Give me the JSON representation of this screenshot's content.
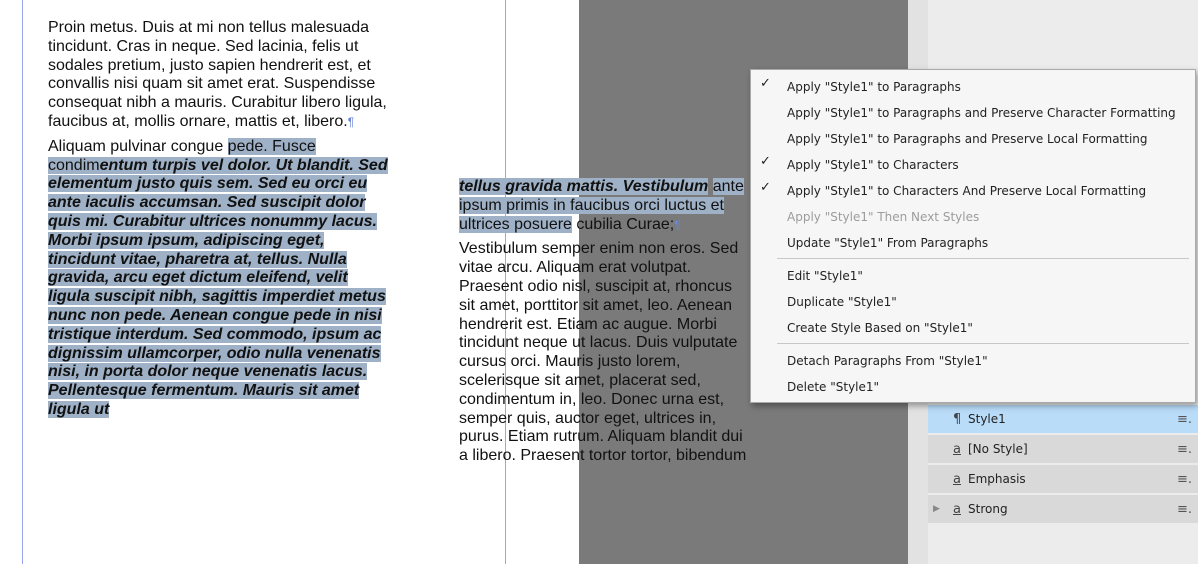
{
  "document": {
    "col1_para1": "Proin metus. Duis at mi non tellus malesuada tincidunt. Cras in neque. Sed lacinia, felis ut sodales pretium, justo sapien hendrerit est, et convallis nisi quam sit amet erat. Suspendisse consequat nibh a mauris. Curabitur libero ligula, faucibus at, mollis ornare, mattis et, libero.",
    "col1_para2_plain": "Aliquam pulvinar congue ",
    "col1_para2_sel_plain": "pede. Fusce condim",
    "col1_para2_sel_bold": "entum turpis vel dolor. Ut blandit. Sed elementum justo quis sem. Sed eu orci eu ante iaculis accumsan. Sed suscipit dolor quis mi. Curabitur ultrices nonummy lacus. Morbi ipsum ipsum, adipiscing eget, tincidunt vitae, pharetra at, tellus. Nulla gravida, arcu eget dictum eleifend, velit ligula suscipit nibh, sagittis imperdiet metus nunc non pede. Aenean congue pede in nisi tristique interdum. Sed commodo, ipsum ac dignissim ullamcorper, odio nulla venenatis nisi, in porta dolor neque venenatis lacus. Pellentesque fermentum. Mauris sit amet ligula ut",
    "col2_sel_bold": "tellus gravida mattis. Vestibulum",
    "col2_sel_plain": "ante ipsum primis in faucibus orci luctus et ultrices posuere",
    "col2_para1_rest": " cubilia Curae;",
    "col2_para2": "Vestibulum semper enim non eros. Sed vitae arcu. Aliquam erat volutpat. Praesent odio nisl, suscipit at, rhoncus sit amet, porttitor sit amet, leo. Aenean hendrerit est. Etiam ac augue. Morbi tincidunt neque ut lacus. Duis vulputate cursus orci. Mauris justo lorem, scelerisque sit amet, placerat sed, condimentum in, leo. Donec urna est, semper quis, auctor eget, ultrices in, purus. Etiam rutrum. Aliquam blandit dui a libero. Praesent tortor tortor, bibendum"
  },
  "context_menu": {
    "items": [
      {
        "label": "Apply \"Style1\" to Paragraphs",
        "checked": true,
        "disabled": false
      },
      {
        "label": "Apply \"Style1\" to Paragraphs and Preserve Character Formatting",
        "checked": false,
        "disabled": false
      },
      {
        "label": "Apply \"Style1\" to Paragraphs and Preserve Local Formatting",
        "checked": false,
        "disabled": false
      },
      {
        "label": "Apply \"Style1\" to Characters",
        "checked": true,
        "disabled": false
      },
      {
        "label": "Apply \"Style1\" to Characters And Preserve Local Formatting",
        "checked": true,
        "disabled": false
      },
      {
        "label": "Apply \"Style1\" Then Next Styles",
        "checked": false,
        "disabled": true
      },
      {
        "label": "Update \"Style1\" From Paragraphs",
        "checked": false,
        "disabled": false
      },
      {
        "label": "Edit \"Style1\"",
        "checked": false,
        "disabled": false
      },
      {
        "label": "Duplicate \"Style1\"",
        "checked": false,
        "disabled": false
      },
      {
        "label": "Create Style Based on \"Style1\"",
        "checked": false,
        "disabled": false
      },
      {
        "label": "Detach Paragraphs From \"Style1\"",
        "checked": false,
        "disabled": false
      },
      {
        "label": "Delete \"Style1\"",
        "checked": false,
        "disabled": false
      }
    ],
    "check_glyph": "✓"
  },
  "styles_panel": {
    "items": [
      {
        "label": "Style1",
        "icon": "paragraph-style-icon",
        "glyph": "¶",
        "selected": true,
        "expandable": false
      },
      {
        "label": "[No Style]",
        "icon": "character-style-icon",
        "glyph": "a",
        "selected": false,
        "expandable": false
      },
      {
        "label": "Emphasis",
        "icon": "character-style-icon",
        "glyph": "a",
        "selected": false,
        "expandable": false
      },
      {
        "label": "Strong",
        "icon": "character-style-icon",
        "glyph": "a",
        "selected": false,
        "expandable": true
      }
    ],
    "row_menu_glyph": "≡.",
    "expand_glyph": "▶",
    "selected_color": "#b9dcf9",
    "row_color": "#d9d9d9"
  },
  "colors": {
    "selection": "#9fb1c6",
    "pasteboard": "#7a7a7a",
    "margin_guide": "#9aa6e8"
  }
}
